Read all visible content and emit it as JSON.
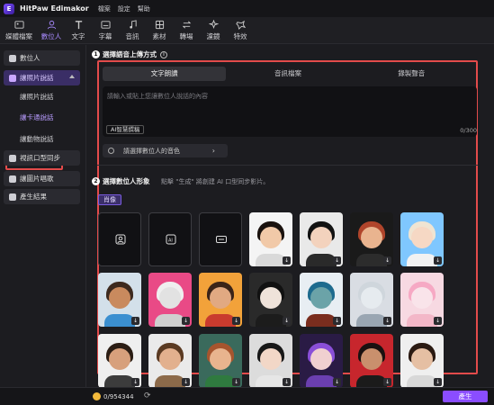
{
  "app": {
    "name": "HitPaw Edimakor",
    "logo_letter": "E"
  },
  "menu": [
    "檔案",
    "設定",
    "幫助"
  ],
  "toolbar": [
    {
      "label": "媒體檔案",
      "icon": "media-icon"
    },
    {
      "label": "數位人",
      "icon": "digital-human-icon",
      "active": true
    },
    {
      "label": "文字",
      "icon": "text-icon"
    },
    {
      "label": "字幕",
      "icon": "subtitle-icon"
    },
    {
      "label": "音訊",
      "icon": "audio-icon"
    },
    {
      "label": "素材",
      "icon": "assets-icon"
    },
    {
      "label": "轉場",
      "icon": "transition-icon"
    },
    {
      "label": "濾鏡",
      "icon": "filter-icon"
    },
    {
      "label": "特效",
      "icon": "effects-icon"
    }
  ],
  "sidebar": {
    "digital_human": "數位人",
    "photo_talk": "讓照片說話",
    "sub_items": [
      "讓照片說話",
      "讓卡通說話",
      "讓動物說話"
    ],
    "lip_sync": "視訊口型同步",
    "photo_sing": "讓圖片唱歌",
    "results": "產生結果"
  },
  "section1": {
    "num": "1",
    "title": "選擇語音上傳方式",
    "info": "i",
    "tabs": [
      "文字朗讀",
      "音訊檔案",
      "錄製聲音"
    ],
    "placeholder": "請輸入或貼上您讓數位人說話的內容",
    "ai_button": "AI智慧撰稿",
    "counter": "0/300",
    "voice_select": "請選擇數位人的音色",
    "voice_chevron": "›"
  },
  "section2": {
    "num": "2",
    "title": "選擇數位人形象",
    "note": "點擊 \"生成\" 將創建 AI 口型同步影片。",
    "chip": "肖像"
  },
  "avatars": [
    {
      "type": "tile",
      "icon": "upload-portrait-icon"
    },
    {
      "type": "tile",
      "icon": "ai-image-icon"
    },
    {
      "type": "tile",
      "icon": "camera-capture-icon"
    },
    {
      "type": "avatar",
      "bg": "#f4f4f4",
      "hair": "#1a120e",
      "skin": "#f1c9a8",
      "cloth": "#d9d9d9"
    },
    {
      "type": "avatar",
      "bg": "#e9e9e9",
      "hair": "#121212",
      "skin": "#f3d2bd",
      "cloth": "#2a2a2a"
    },
    {
      "type": "avatar",
      "bg": "#1a1a1a",
      "hair": "#b0452b",
      "skin": "#e9b48f",
      "cloth": "#2c2c2c"
    },
    {
      "type": "avatar",
      "bg": "#7fc7ff",
      "hair": "#efe4d2",
      "skin": "#f6d8c4",
      "cloth": "#f2f2f2"
    },
    {
      "type": "avatar",
      "bg": "#d3e0ea",
      "hair": "#3d2a1f",
      "skin": "#c98a5e",
      "cloth": "#3b8fd0"
    },
    {
      "type": "avatar",
      "bg": "#e94a86",
      "hair": "#efefef",
      "skin": "#e2e2e2",
      "cloth": "#cfcfcf"
    },
    {
      "type": "avatar",
      "bg": "#f2a23a",
      "hair": "#3b2418",
      "skin": "#e1a982",
      "cloth": "#c93b2e"
    },
    {
      "type": "avatar",
      "bg": "#2a2a2a",
      "hair": "#111111",
      "skin": "#efe3da",
      "cloth": "#1c1c1c"
    },
    {
      "type": "avatar",
      "bg": "#e8eef3",
      "hair": "#1e6b8e",
      "skin": "#6ba3a8",
      "cloth": "#7a2d1e"
    },
    {
      "type": "avatar",
      "bg": "#d9dde3",
      "hair": "#cfd6dc",
      "skin": "#e6ebef",
      "cloth": "#9aa6b2"
    },
    {
      "type": "avatar",
      "bg": "#f7d9e2",
      "hair": "#f6a9c4",
      "skin": "#f9e4ea",
      "cloth": "#f3b7c8"
    },
    {
      "type": "avatar",
      "bg": "#efefef",
      "hair": "#2b1d14",
      "skin": "#d7a07c",
      "cloth": "#3c3c3c"
    },
    {
      "type": "avatar",
      "bg": "#eaeaea",
      "hair": "#5a3a22",
      "skin": "#e2b08e",
      "cloth": "#8c6a4a"
    },
    {
      "type": "avatar",
      "bg": "#3a6a5c",
      "hair": "#a6552e",
      "skin": "#e8b48e",
      "cloth": "#2f7a3f"
    },
    {
      "type": "avatar",
      "bg": "#dcdcdc",
      "hair": "#181818",
      "skin": "#f2d7c7",
      "cloth": "#e6e6e6"
    },
    {
      "type": "avatar",
      "bg": "#2a1b45",
      "hair": "#8a4fd8",
      "skin": "#f0d0d0",
      "cloth": "#6b3fb0"
    },
    {
      "type": "avatar",
      "bg": "#c7262d",
      "hair": "#1a1110",
      "skin": "#c9906d",
      "cloth": "#1b1b1b"
    },
    {
      "type": "avatar",
      "bg": "#efefef",
      "hair": "#2a1a12",
      "skin": "#e5bfa3",
      "cloth": "#d8d8d8"
    }
  ],
  "download_glyph": "↓",
  "bottom": {
    "credits": "0/954344",
    "refresh_glyph": "⟳",
    "generate": "產生"
  },
  "colors": {
    "accent": "#8a4dff",
    "highlight_border": "#e34b4b",
    "coin": "#f2b93b"
  }
}
